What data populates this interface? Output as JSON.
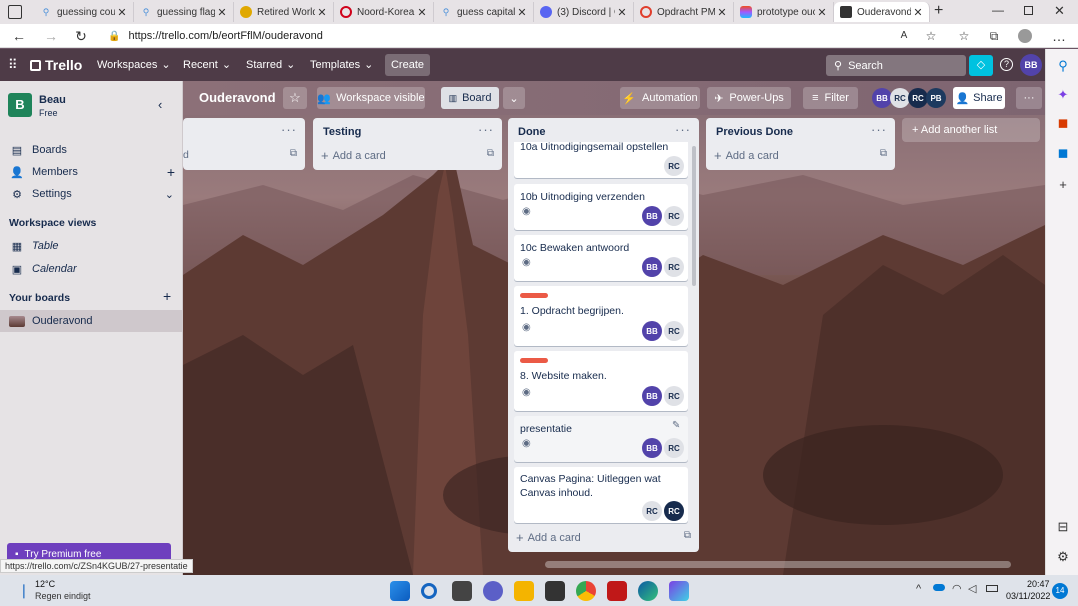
{
  "browser": {
    "tabs": [
      {
        "title": "guessing cou",
        "fav": "search-favicon",
        "color": "#4a90d9"
      },
      {
        "title": "guessing flag",
        "fav": "search-favicon",
        "color": "#4a90d9"
      },
      {
        "title": "Retired World",
        "fav": "bulb-favicon",
        "color": "#e0a800"
      },
      {
        "title": "Noord-Korea",
        "fav": "opera-favicon",
        "color": "#d0021b"
      },
      {
        "title": "guess capitals",
        "fav": "search-favicon",
        "color": "#4a90d9"
      },
      {
        "title": "(3) Discord | C",
        "fav": "discord-favicon",
        "color": "#5865f2"
      },
      {
        "title": "Opdracht PM",
        "fav": "opdracht-favicon",
        "color": "#e03e2d"
      },
      {
        "title": "prototype ouc",
        "fav": "figma-favicon",
        "color": "#f24e1e"
      },
      {
        "title": "Ouderavond |",
        "fav": "trello-favicon",
        "color": "#0079bf"
      }
    ],
    "url": "https://trello.com/b/eortFflM/ouderavond",
    "status_url": "https://trello.com/c/ZSn4KGUB/27-presentatie"
  },
  "header": {
    "logo": "Trello",
    "nav": [
      "Workspaces",
      "Recent",
      "Starred",
      "Templates"
    ],
    "create": "Create",
    "search_placeholder": "Search",
    "user_initials": "BB"
  },
  "sidebar": {
    "workspace_letter": "B",
    "workspace_name": "Beau",
    "workspace_plan": "Free",
    "items": [
      {
        "label": "Boards",
        "icon": "board-icon"
      },
      {
        "label": "Members",
        "icon": "members-icon"
      },
      {
        "label": "Settings",
        "icon": "gear-icon"
      }
    ],
    "views_heading": "Workspace views",
    "views": [
      {
        "label": "Table",
        "icon": "table-icon"
      },
      {
        "label": "Calendar",
        "icon": "calendar-icon"
      }
    ],
    "your_boards": "Your boards",
    "boards": [
      "Ouderavond"
    ],
    "premium": "Try Premium free"
  },
  "board": {
    "title": "Ouderavond",
    "visibility": "Workspace visible",
    "view": "Board",
    "automation": "Automation",
    "powerups": "Power-Ups",
    "filter": "Filter",
    "share": "Share",
    "members": [
      "BB",
      "RC",
      "RC",
      "PB"
    ],
    "add_list": "+ Add another list",
    "add_card": "Add a card",
    "lists": [
      {
        "title": "",
        "card_text": "d"
      },
      {
        "title": "Testing"
      },
      {
        "title": "Done"
      },
      {
        "title": "Previous Done"
      }
    ],
    "done_cards": [
      {
        "title": "10a Uitnodigingsemail opstellen",
        "members": [
          "RC"
        ]
      },
      {
        "title": "10b Uitnodiging verzenden",
        "members": [
          "BB",
          "RC"
        ]
      },
      {
        "title": "10c Bewaken antwoord",
        "members": [
          "BB",
          "RC"
        ]
      },
      {
        "title": "1. Opdracht begrijpen.",
        "members": [
          "BB",
          "RC"
        ],
        "label_color": "#eb5a46"
      },
      {
        "title": "8. Website maken.",
        "members": [
          "BB",
          "RC"
        ],
        "label_color": "#eb5a46"
      },
      {
        "title": "presentatie",
        "members": [
          "BB",
          "RC"
        ]
      },
      {
        "title": "Canvas Pagina: Uitleggen wat Canvas inhoud.",
        "members": [
          "RC",
          "RC"
        ]
      }
    ]
  },
  "taskbar": {
    "temp": "12°C",
    "weather": "Regen eindigt",
    "time": "20:47",
    "date": "03/11/2022",
    "notifications": "14"
  }
}
